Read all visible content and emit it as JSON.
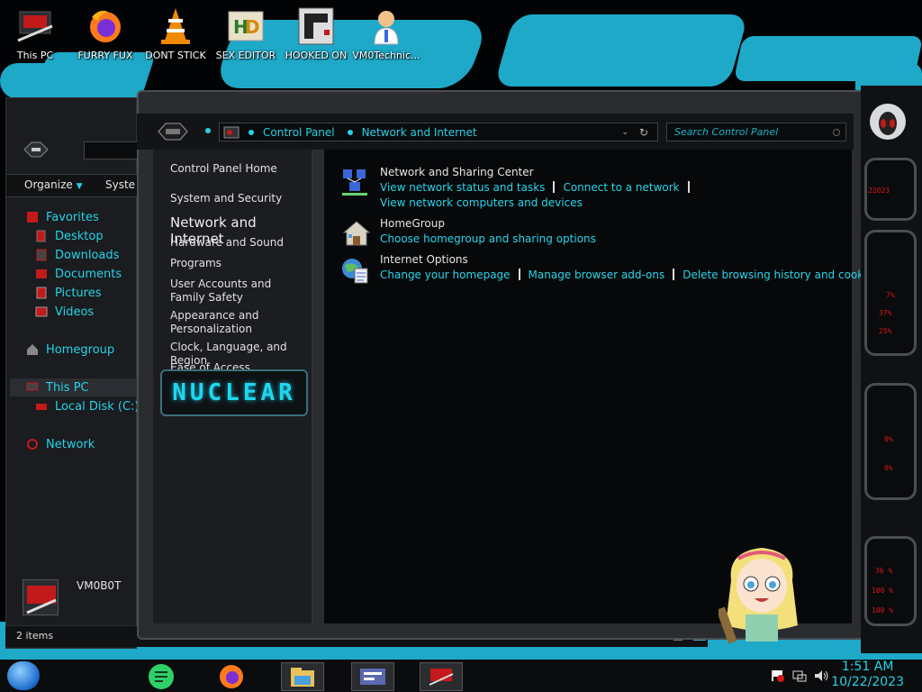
{
  "desktop": {
    "icons": [
      {
        "label": "This PC"
      },
      {
        "label": "FURRY FUX"
      },
      {
        "label": "DONT STICK"
      },
      {
        "label": "SEX EDITOR"
      },
      {
        "label": "HOOKED ON"
      },
      {
        "label": "VM0Technic..."
      }
    ]
  },
  "explorer": {
    "toolbar": {
      "organize": "Organize",
      "system": "Syste"
    },
    "nav": {
      "favorites": "Favorites",
      "desktop": "Desktop",
      "downloads": "Downloads",
      "documents": "Documents",
      "pictures": "Pictures",
      "videos": "Videos",
      "homegroup": "Homegroup",
      "this_pc": "This PC",
      "local_disk": "Local Disk (C:)",
      "network": "Network"
    },
    "computer_name": "VM0B0T",
    "status": "2 items"
  },
  "control_panel": {
    "breadcrumb": [
      "Control Panel",
      "Network and Internet"
    ],
    "search_placeholder": "Search Control Panel",
    "sidebar": {
      "home": "Control Panel Home",
      "items": [
        "System and Security",
        "Network and Internet",
        "Hardware and Sound",
        "Programs",
        "User Accounts and Family Safety",
        "Appearance and Personalization",
        "Clock, Language, and Region",
        "Ease of Access"
      ],
      "logo_text": "NUCLEAR"
    },
    "categories": [
      {
        "title": "Network and Sharing Center",
        "links": [
          "View network status and tasks",
          "Connect to a network",
          "View network computers and devices"
        ],
        "icon": "network-sharing-icon"
      },
      {
        "title": "HomeGroup",
        "links": [
          "Choose homegroup and sharing options"
        ],
        "icon": "homegroup-icon"
      },
      {
        "title": "Internet Options",
        "links": [
          "Change your homepage",
          "Manage browser add-ons",
          "Delete browsing history and cookies"
        ],
        "icon": "internet-options-icon"
      }
    ]
  },
  "gadget": {
    "readouts": [
      "22023",
      "7%",
      "37%",
      "25%",
      "0%",
      "0%",
      "36 %",
      "100 %",
      "100 %"
    ]
  },
  "taskbar": {
    "time": "1:51 AM",
    "date": "10/22/2023"
  },
  "colors": {
    "accent": "#1fc8dd",
    "wallpaper_paint": "#1ea9c9",
    "alert_red": "#d81818"
  }
}
